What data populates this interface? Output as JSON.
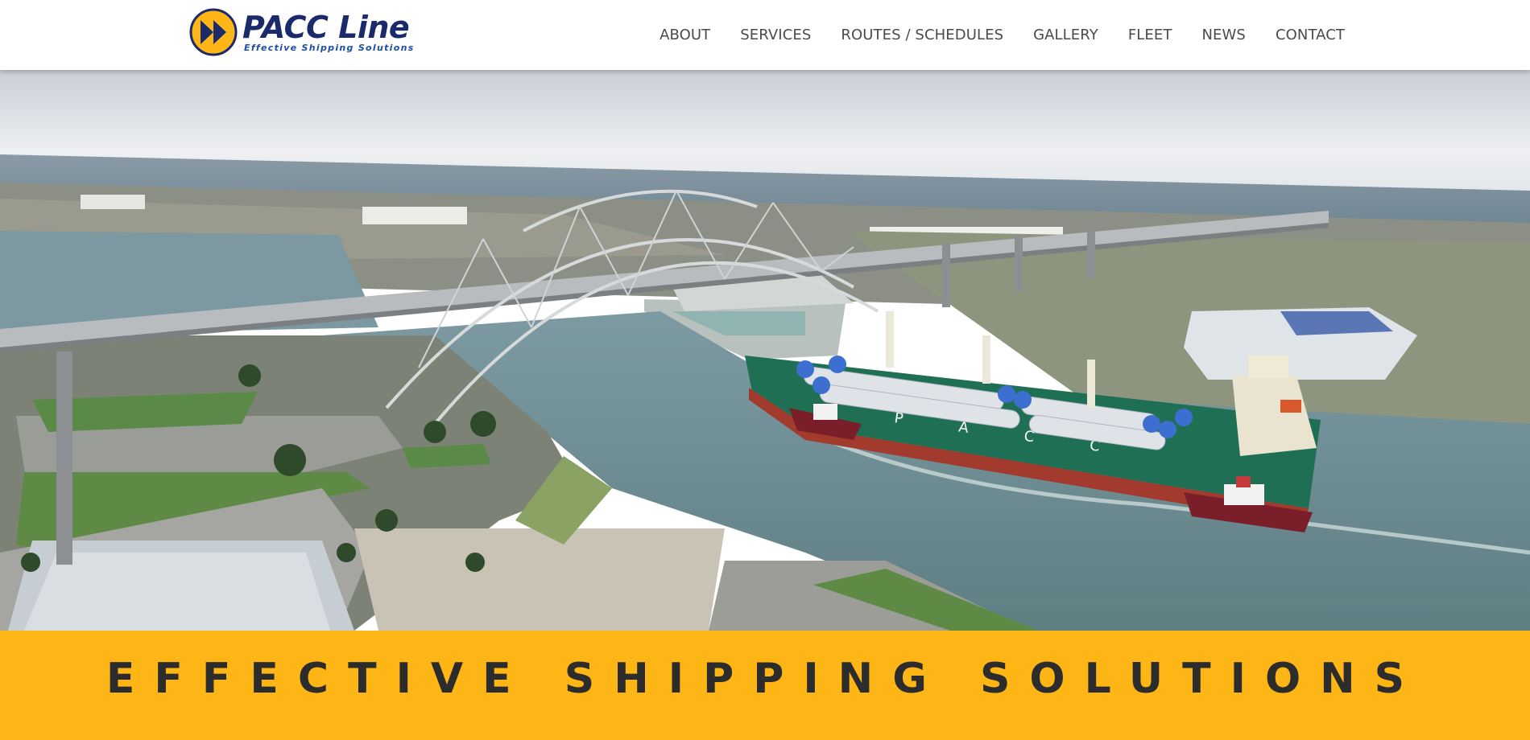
{
  "header": {
    "logo": {
      "name": "PACC Line",
      "tagline": "Effective Shipping Solutions",
      "mark_icon": "double-chevron-icon",
      "colors": {
        "mark_fill": "#fdb615",
        "mark_outline": "#1b2a6b",
        "name": "#1b2a6b",
        "tagline": "#1b4fa8"
      }
    },
    "nav": [
      {
        "label": "ABOUT"
      },
      {
        "label": "SERVICES"
      },
      {
        "label": "ROUTES / SCHEDULES"
      },
      {
        "label": "GALLERY"
      },
      {
        "label": "FLEET"
      },
      {
        "label": "NEWS"
      },
      {
        "label": "CONTACT"
      }
    ]
  },
  "hero": {
    "ship_hull_lettering": "P A C C"
  },
  "banner": {
    "text": "EFFECTIVE SHIPPING SOLUTIONS",
    "background": "#fdb615"
  }
}
